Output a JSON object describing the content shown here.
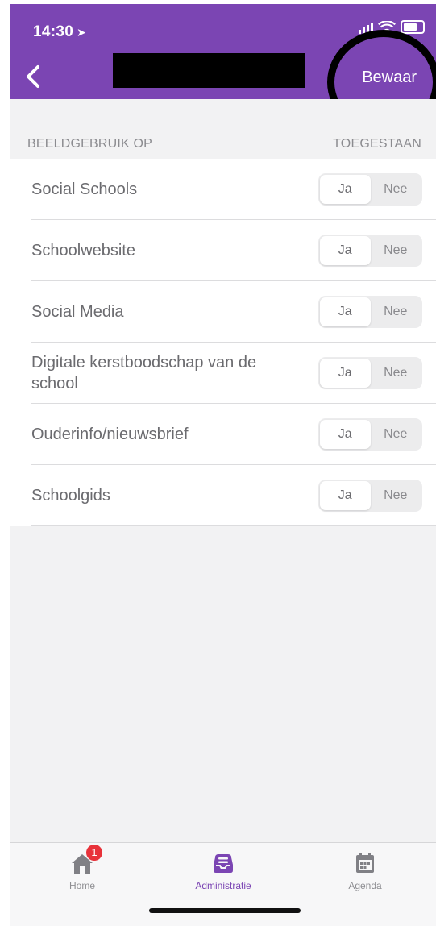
{
  "status_bar": {
    "time": "14:30",
    "location_icon": "location-arrow-icon"
  },
  "header": {
    "save_label": "Bewaar",
    "background": "#7b45b3"
  },
  "section": {
    "left_title": "BEELDGEBRUIK OP",
    "right_title": "TOEGESTAAN"
  },
  "items": [
    {
      "label": "Social Schools",
      "yes": "Ja",
      "no": "Nee",
      "selected": "Ja"
    },
    {
      "label": "Schoolwebsite",
      "yes": "Ja",
      "no": "Nee",
      "selected": "Ja"
    },
    {
      "label": "Social Media",
      "yes": "Ja",
      "no": "Nee",
      "selected": "Ja"
    },
    {
      "label": "Digitale kerstboodschap van de school",
      "yes": "Ja",
      "no": "Nee",
      "selected": "Ja"
    },
    {
      "label": "Ouderinfo/nieuwsbrief",
      "yes": "Ja",
      "no": "Nee",
      "selected": "Ja"
    },
    {
      "label": "Schoolgids",
      "yes": "Ja",
      "no": "Nee",
      "selected": "Ja"
    }
  ],
  "tabs": [
    {
      "label": "Home",
      "icon": "home-icon",
      "badge": "1",
      "active": false
    },
    {
      "label": "Administratie",
      "icon": "inbox-icon",
      "active": true
    },
    {
      "label": "Agenda",
      "icon": "calendar-icon",
      "active": false
    }
  ],
  "colors": {
    "accent": "#7b45b3",
    "badge": "#e8323a"
  }
}
